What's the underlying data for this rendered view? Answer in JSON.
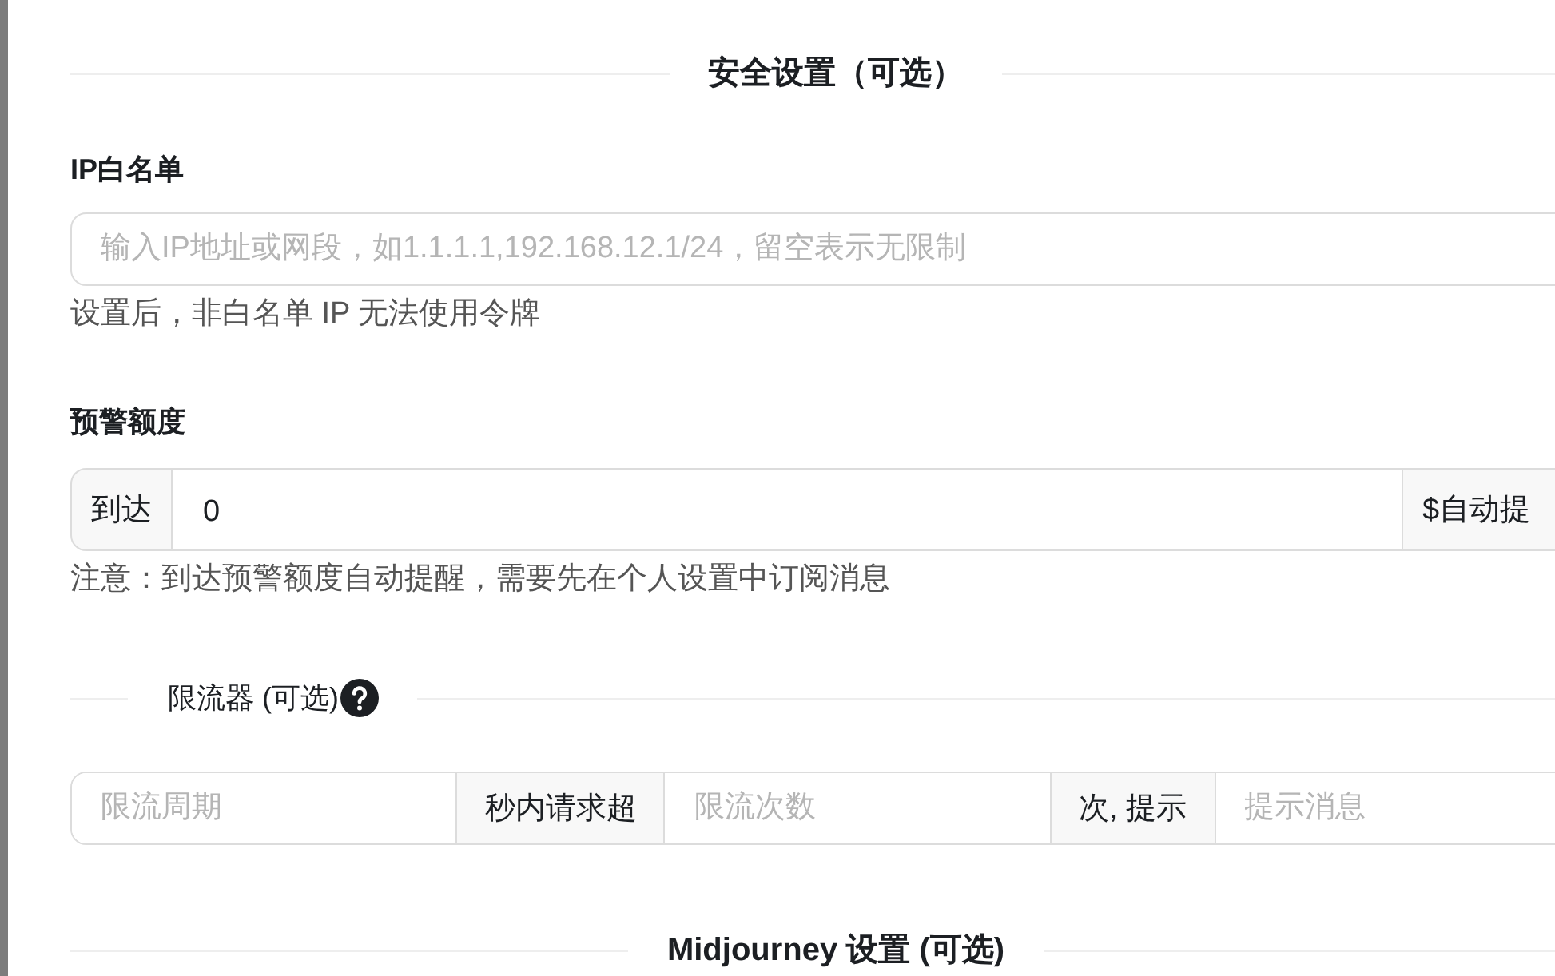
{
  "security_section": {
    "title": "安全设置（可选）"
  },
  "ip_whitelist": {
    "label": "IP白名单",
    "placeholder": "输入IP地址或网段，如1.1.1.1,192.168.12.1/24，留空表示无限制",
    "help": "设置后，非白名单 IP 无法使用令牌"
  },
  "quota_warning": {
    "label": "预警额度",
    "prefix": "到达",
    "value": "0",
    "suffix": "$自动提",
    "note": "注意：到达预警额度自动提醒，需要先在个人设置中订阅消息"
  },
  "rate_limiter": {
    "title": "限流器 (可选)",
    "fields": [
      {
        "kind": "input",
        "placeholder": "限流周期"
      },
      {
        "kind": "addon",
        "text": "秒内请求超"
      },
      {
        "kind": "input",
        "placeholder": "限流次数"
      },
      {
        "kind": "addon",
        "text": "次, 提示"
      },
      {
        "kind": "input",
        "placeholder": "提示消息"
      }
    ]
  },
  "midjourney_section": {
    "title": "Midjourney 设置 (可选)"
  }
}
